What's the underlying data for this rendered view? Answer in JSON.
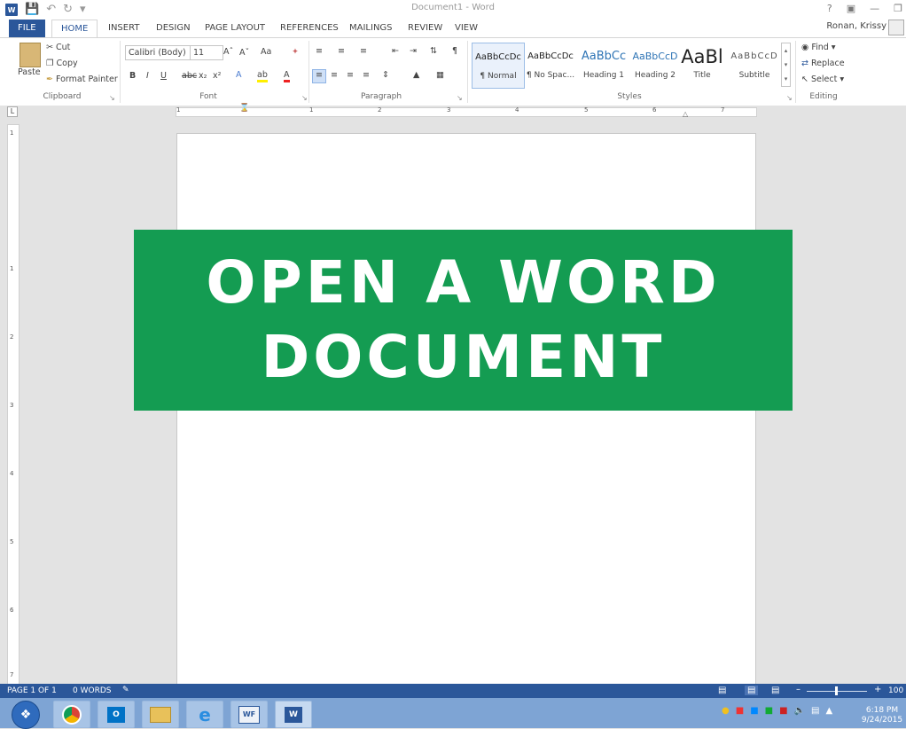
{
  "window": {
    "title": "Document1 - Word",
    "user": "Ronan, Krissy"
  },
  "tabs": [
    "FILE",
    "HOME",
    "INSERT",
    "DESIGN",
    "PAGE LAYOUT",
    "REFERENCES",
    "MAILINGS",
    "REVIEW",
    "VIEW"
  ],
  "clipboard": {
    "paste": "Paste",
    "cut": "Cut",
    "copy": "Copy",
    "format_painter": "Format Painter",
    "label": "Clipboard"
  },
  "font": {
    "name": "Calibri (Body)",
    "size": "11",
    "case": "Aa",
    "label": "Font"
  },
  "paragraph": {
    "label": "Paragraph"
  },
  "styles": {
    "items": [
      {
        "sample": "AaBbCcDc",
        "name": "¶ Normal"
      },
      {
        "sample": "AaBbCcDc",
        "name": "¶ No Spac..."
      },
      {
        "sample": "AaBbCc",
        "name": "Heading 1"
      },
      {
        "sample": "AaBbCcD",
        "name": "Heading 2"
      },
      {
        "sample": "AaBl",
        "name": "Title"
      },
      {
        "sample": "AaBbCcD",
        "name": "Subtitle"
      }
    ],
    "label": "Styles"
  },
  "editing": {
    "find": "Find",
    "replace": "Replace",
    "select": "Select",
    "label": "Editing"
  },
  "ruler": {
    "h": [
      "1",
      "1",
      "2",
      "3",
      "4",
      "5",
      "6",
      "7"
    ],
    "v": [
      "1",
      "1",
      "2",
      "3",
      "4",
      "5",
      "6",
      "7"
    ]
  },
  "banner": {
    "line1": "OPEN A WORD",
    "line2": "DOCUMENT"
  },
  "status": {
    "page": "PAGE 1 OF 1",
    "words": "0 WORDS",
    "zoom": "100"
  },
  "tray": {
    "time": "6:18 PM",
    "date": "9/24/2015"
  },
  "colors": {
    "word_blue": "#2b579a",
    "banner_green": "#149c52"
  }
}
